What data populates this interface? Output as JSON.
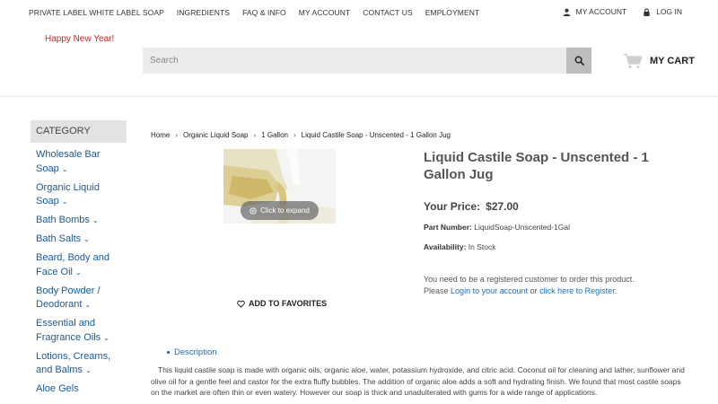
{
  "topnav": {
    "links": [
      "PRIVATE LABEL WHITE LABEL SOAP",
      "INGREDIENTS",
      "FAQ & INFO",
      "MY ACCOUNT",
      "CONTACT US",
      "EMPLOYMENT"
    ],
    "account_label": "MY ACCOUNT",
    "login_label": "LOG IN"
  },
  "promo": "Happy New Year!",
  "search": {
    "placeholder": "Search",
    "value": ""
  },
  "cart": {
    "label": "MY CART"
  },
  "sidebar": {
    "heading": "CATEGORY",
    "items": [
      {
        "label": "Wholesale Bar Soap",
        "has_chevron": true
      },
      {
        "label": "Organic Liquid Soap",
        "has_chevron": true
      },
      {
        "label": "Bath Bombs",
        "has_chevron": true
      },
      {
        "label": "Bath Salts",
        "has_chevron": true
      },
      {
        "label": "Beard, Body and Face Oil",
        "has_chevron": true
      },
      {
        "label": "Body Powder / Deodorant",
        "has_chevron": true
      },
      {
        "label": "Essential and Fragrance Oils",
        "has_chevron": true
      },
      {
        "label": "Lotions, Creams, and Balms",
        "has_chevron": true
      },
      {
        "label": "Aloe Gels",
        "has_chevron": false
      }
    ]
  },
  "breadcrumb": [
    "Home",
    "Organic Liquid Soap",
    "1 Gallon",
    "Liquid Castile Soap - Unscented - 1 Gallon Jug"
  ],
  "image": {
    "expand_label": "Click to expand"
  },
  "favorites_label": "ADD TO FAVORITES",
  "product": {
    "title": "Liquid Castile Soap - Unscented - 1 Gallon Jug",
    "price_label": "Your Price:",
    "price": "$27.00",
    "part_label": "Part Number:",
    "part_number": "LiquidSoap-Unscented-1Gal",
    "availability_label": "Availability:",
    "availability": "In Stock",
    "notice_text": "You need to be a registered customer to order this product.",
    "notice_please": "Please",
    "notice_login": "Login to your account",
    "notice_or": "or",
    "notice_register": "click here to Register."
  },
  "description": {
    "tab_label": "Description",
    "text": "This liquid castile soap is made with organic oils, organic aloe, water, potassium hydroxide, and citric acid. Coconut oil for cleaning and lather, sunflower and olive oil for a gentle feel and castor for the extra fluffy bubbles. The addition of organic aloe adds a soft and hydrating finish. We found that most castile soaps on the market are often thin or even watery. However our soap is thick and unadulterated with gums for a wide range of applications."
  },
  "colors": {
    "accent": "#1a6fb5",
    "promo": "#d32020",
    "sidebar_head": "#e3e3e3"
  },
  "icons": [
    "user-icon",
    "lock-icon",
    "search-icon",
    "cart-icon",
    "zoom-icon",
    "heart-icon",
    "chevron-down-icon"
  ]
}
